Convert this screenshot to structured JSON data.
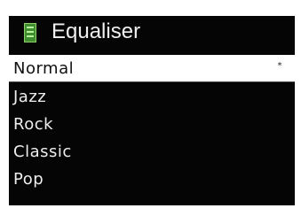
{
  "header": {
    "icon": "equaliser-icon",
    "title": "Equaliser"
  },
  "menu": {
    "items": [
      {
        "label": "Normal",
        "selected": true,
        "marker": "*"
      },
      {
        "label": "Jazz"
      },
      {
        "label": "Rock"
      },
      {
        "label": "Classic"
      },
      {
        "label": "Pop"
      }
    ]
  },
  "colors": {
    "screen_background": "#050505",
    "icon_green": "#3f8e2f",
    "selection_background": "#ffffff",
    "text": "#eeeeee"
  }
}
